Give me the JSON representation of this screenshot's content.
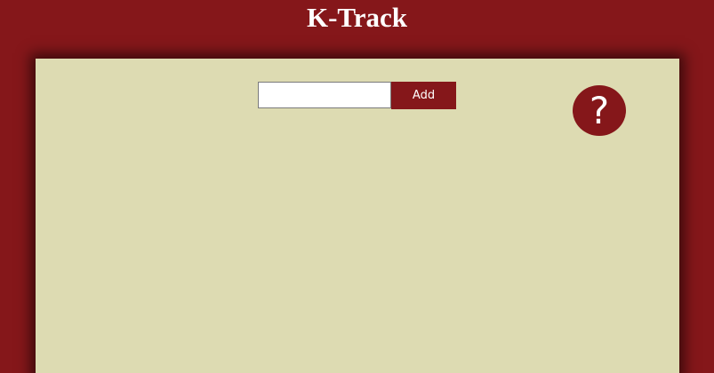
{
  "header": {
    "title": "K-Track"
  },
  "add_form": {
    "input_value": "",
    "input_placeholder": "",
    "add_label": "Add"
  },
  "help": {
    "icon": "question-mark-icon",
    "glyph": "?"
  },
  "colors": {
    "brand": "#85171a",
    "panel": "#dddbb2",
    "text_on_brand": "#ffffff"
  }
}
